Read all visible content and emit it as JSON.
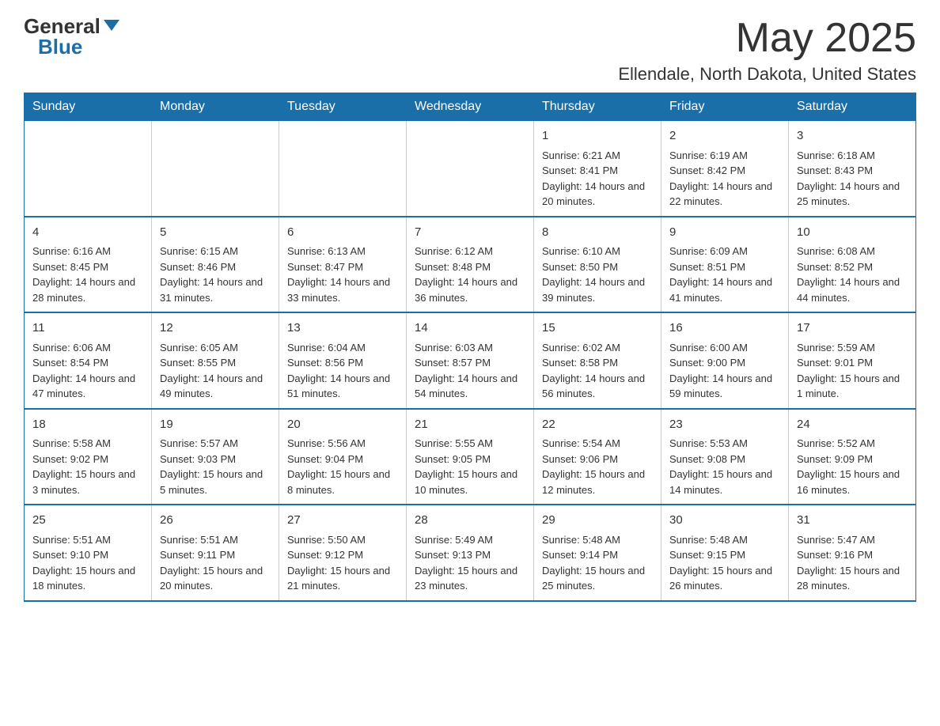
{
  "header": {
    "logo_general": "General",
    "logo_blue": "Blue",
    "month_title": "May 2025",
    "location": "Ellendale, North Dakota, United States"
  },
  "days_of_week": [
    "Sunday",
    "Monday",
    "Tuesday",
    "Wednesday",
    "Thursday",
    "Friday",
    "Saturday"
  ],
  "weeks": [
    {
      "days": [
        {
          "number": "",
          "info": ""
        },
        {
          "number": "",
          "info": ""
        },
        {
          "number": "",
          "info": ""
        },
        {
          "number": "",
          "info": ""
        },
        {
          "number": "1",
          "info": "Sunrise: 6:21 AM\nSunset: 8:41 PM\nDaylight: 14 hours and 20 minutes."
        },
        {
          "number": "2",
          "info": "Sunrise: 6:19 AM\nSunset: 8:42 PM\nDaylight: 14 hours and 22 minutes."
        },
        {
          "number": "3",
          "info": "Sunrise: 6:18 AM\nSunset: 8:43 PM\nDaylight: 14 hours and 25 minutes."
        }
      ]
    },
    {
      "days": [
        {
          "number": "4",
          "info": "Sunrise: 6:16 AM\nSunset: 8:45 PM\nDaylight: 14 hours and 28 minutes."
        },
        {
          "number": "5",
          "info": "Sunrise: 6:15 AM\nSunset: 8:46 PM\nDaylight: 14 hours and 31 minutes."
        },
        {
          "number": "6",
          "info": "Sunrise: 6:13 AM\nSunset: 8:47 PM\nDaylight: 14 hours and 33 minutes."
        },
        {
          "number": "7",
          "info": "Sunrise: 6:12 AM\nSunset: 8:48 PM\nDaylight: 14 hours and 36 minutes."
        },
        {
          "number": "8",
          "info": "Sunrise: 6:10 AM\nSunset: 8:50 PM\nDaylight: 14 hours and 39 minutes."
        },
        {
          "number": "9",
          "info": "Sunrise: 6:09 AM\nSunset: 8:51 PM\nDaylight: 14 hours and 41 minutes."
        },
        {
          "number": "10",
          "info": "Sunrise: 6:08 AM\nSunset: 8:52 PM\nDaylight: 14 hours and 44 minutes."
        }
      ]
    },
    {
      "days": [
        {
          "number": "11",
          "info": "Sunrise: 6:06 AM\nSunset: 8:54 PM\nDaylight: 14 hours and 47 minutes."
        },
        {
          "number": "12",
          "info": "Sunrise: 6:05 AM\nSunset: 8:55 PM\nDaylight: 14 hours and 49 minutes."
        },
        {
          "number": "13",
          "info": "Sunrise: 6:04 AM\nSunset: 8:56 PM\nDaylight: 14 hours and 51 minutes."
        },
        {
          "number": "14",
          "info": "Sunrise: 6:03 AM\nSunset: 8:57 PM\nDaylight: 14 hours and 54 minutes."
        },
        {
          "number": "15",
          "info": "Sunrise: 6:02 AM\nSunset: 8:58 PM\nDaylight: 14 hours and 56 minutes."
        },
        {
          "number": "16",
          "info": "Sunrise: 6:00 AM\nSunset: 9:00 PM\nDaylight: 14 hours and 59 minutes."
        },
        {
          "number": "17",
          "info": "Sunrise: 5:59 AM\nSunset: 9:01 PM\nDaylight: 15 hours and 1 minute."
        }
      ]
    },
    {
      "days": [
        {
          "number": "18",
          "info": "Sunrise: 5:58 AM\nSunset: 9:02 PM\nDaylight: 15 hours and 3 minutes."
        },
        {
          "number": "19",
          "info": "Sunrise: 5:57 AM\nSunset: 9:03 PM\nDaylight: 15 hours and 5 minutes."
        },
        {
          "number": "20",
          "info": "Sunrise: 5:56 AM\nSunset: 9:04 PM\nDaylight: 15 hours and 8 minutes."
        },
        {
          "number": "21",
          "info": "Sunrise: 5:55 AM\nSunset: 9:05 PM\nDaylight: 15 hours and 10 minutes."
        },
        {
          "number": "22",
          "info": "Sunrise: 5:54 AM\nSunset: 9:06 PM\nDaylight: 15 hours and 12 minutes."
        },
        {
          "number": "23",
          "info": "Sunrise: 5:53 AM\nSunset: 9:08 PM\nDaylight: 15 hours and 14 minutes."
        },
        {
          "number": "24",
          "info": "Sunrise: 5:52 AM\nSunset: 9:09 PM\nDaylight: 15 hours and 16 minutes."
        }
      ]
    },
    {
      "days": [
        {
          "number": "25",
          "info": "Sunrise: 5:51 AM\nSunset: 9:10 PM\nDaylight: 15 hours and 18 minutes."
        },
        {
          "number": "26",
          "info": "Sunrise: 5:51 AM\nSunset: 9:11 PM\nDaylight: 15 hours and 20 minutes."
        },
        {
          "number": "27",
          "info": "Sunrise: 5:50 AM\nSunset: 9:12 PM\nDaylight: 15 hours and 21 minutes."
        },
        {
          "number": "28",
          "info": "Sunrise: 5:49 AM\nSunset: 9:13 PM\nDaylight: 15 hours and 23 minutes."
        },
        {
          "number": "29",
          "info": "Sunrise: 5:48 AM\nSunset: 9:14 PM\nDaylight: 15 hours and 25 minutes."
        },
        {
          "number": "30",
          "info": "Sunrise: 5:48 AM\nSunset: 9:15 PM\nDaylight: 15 hours and 26 minutes."
        },
        {
          "number": "31",
          "info": "Sunrise: 5:47 AM\nSunset: 9:16 PM\nDaylight: 15 hours and 28 minutes."
        }
      ]
    }
  ]
}
